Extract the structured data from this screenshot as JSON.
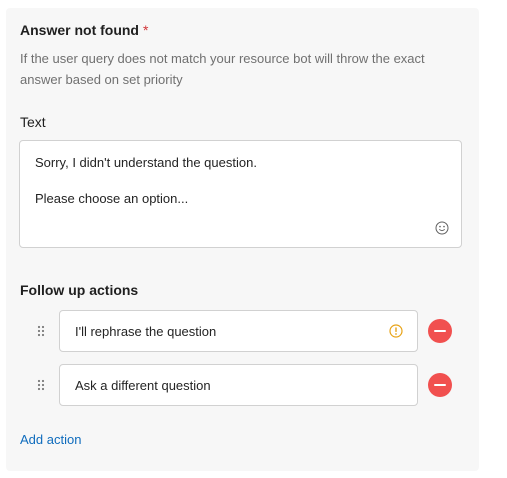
{
  "answer_not_found": {
    "title": "Answer not found",
    "required_marker": "*",
    "description": "If the user query does not match your resource bot will throw the exact answer based on set priority"
  },
  "text_field": {
    "label": "Text",
    "lines": [
      "Sorry, I didn't understand the question.",
      "Please choose an option..."
    ],
    "icon": "emoji-icon"
  },
  "follow_up": {
    "label": "Follow up actions",
    "actions": [
      {
        "value": "I'll rephrase the question",
        "warning": true
      },
      {
        "value": "Ask a different question",
        "warning": false
      }
    ],
    "add_label": "Add action"
  },
  "colors": {
    "panel_bg": "#f7f7f7",
    "required": "#d13438",
    "remove": "#f1504f",
    "warning": "#e8a317",
    "link": "#0f6cbd"
  }
}
